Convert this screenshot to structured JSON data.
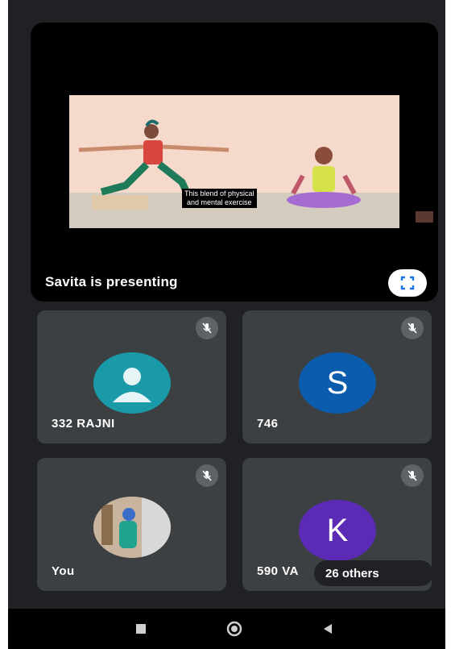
{
  "presentation": {
    "presenting_label": "Savita is presenting",
    "caption_line1": "This blend of physical",
    "caption_line2": "and mental exercise"
  },
  "participants": [
    {
      "name": "332 RAJNI",
      "avatar": "person-silhouette",
      "avatar_color": "#1a9aa8",
      "muted": true
    },
    {
      "name": "746",
      "avatar_letter": "S",
      "avatar_color": "#0b5cad",
      "muted": true
    },
    {
      "name": "You",
      "avatar": "photo",
      "muted": true
    },
    {
      "name": "590 VA",
      "avatar_letter": "K",
      "avatar_color": "#5b2bb5",
      "muted": true
    }
  ],
  "others_chip": "26 others",
  "icons": {
    "mute": "mic-off-icon",
    "fullscreen": "fullscreen-icon",
    "nav_recents": "square-icon",
    "nav_home": "circle-icon",
    "nav_back": "triangle-back-icon"
  }
}
